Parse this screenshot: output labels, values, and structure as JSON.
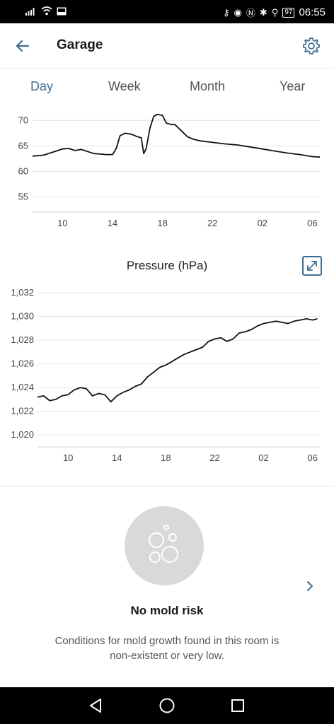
{
  "status_bar": {
    "battery": "97",
    "time": "06:55"
  },
  "header": {
    "title": "Garage",
    "back_icon": "arrow-left-icon",
    "settings_icon": "gear-icon"
  },
  "tabs": [
    {
      "label": "Day",
      "active": true
    },
    {
      "label": "Week",
      "active": false
    },
    {
      "label": "Month",
      "active": false
    },
    {
      "label": "Year",
      "active": false
    }
  ],
  "colors": {
    "accent": "#3f6e93",
    "line": "#111111",
    "grid": "#e6e6e6"
  },
  "chart_data": [
    {
      "type": "line",
      "title": "",
      "xlabel": "",
      "ylabel": "",
      "x_ticks": [
        "10",
        "14",
        "18",
        "22",
        "02",
        "06"
      ],
      "y_ticks": [
        "70",
        "65",
        "60",
        "55"
      ],
      "ylim": [
        52,
        72
      ],
      "xlim": [
        7.6,
        30.6
      ],
      "grid": true,
      "series": [
        {
          "x": [
            7.6,
            8.5,
            9.0,
            9.5,
            10.0,
            10.5,
            11.0,
            11.5,
            12.0,
            12.5,
            13.0,
            13.5,
            14.0,
            14.3,
            14.6,
            15.0,
            15.5,
            16.0,
            16.3,
            16.5,
            16.7,
            17.0,
            17.3,
            17.6,
            18.0,
            18.3,
            18.7,
            19.0,
            19.5,
            20.0,
            20.5,
            21.0,
            22.0,
            23.0,
            24.0,
            25.0,
            26.0,
            27.0,
            28.0,
            29.0,
            30.0,
            30.6
          ],
          "values": [
            63.0,
            63.2,
            63.6,
            64.0,
            64.4,
            64.5,
            64.1,
            64.3,
            63.9,
            63.5,
            63.4,
            63.3,
            63.3,
            64.5,
            67.0,
            67.5,
            67.3,
            66.8,
            66.6,
            63.5,
            64.5,
            68.5,
            70.8,
            71.2,
            71.0,
            69.5,
            69.2,
            69.2,
            68.0,
            66.8,
            66.3,
            66.0,
            65.7,
            65.4,
            65.2,
            64.8,
            64.4,
            64.0,
            63.6,
            63.3,
            62.9,
            62.8
          ]
        }
      ]
    },
    {
      "type": "line",
      "title": "Pressure (hPa)",
      "xlabel": "",
      "ylabel": "",
      "x_ticks": [
        "10",
        "14",
        "18",
        "22",
        "02",
        "06"
      ],
      "y_ticks": [
        "1,032",
        "1,030",
        "1,028",
        "1,026",
        "1,024",
        "1,022",
        "1,020"
      ],
      "ylim": [
        1019,
        1032
      ],
      "xlim": [
        7.5,
        30.6
      ],
      "grid": true,
      "series": [
        {
          "x": [
            7.5,
            8.0,
            8.5,
            9.0,
            9.5,
            10.0,
            10.5,
            11.0,
            11.5,
            12.0,
            12.5,
            13.0,
            13.5,
            14.0,
            14.5,
            15.0,
            15.5,
            16.0,
            16.5,
            17.0,
            17.5,
            18.0,
            18.5,
            19.0,
            19.5,
            20.0,
            20.5,
            21.0,
            21.5,
            22.0,
            22.5,
            23.0,
            23.5,
            24.0,
            24.5,
            25.0,
            25.5,
            26.0,
            26.5,
            27.0,
            27.5,
            28.0,
            28.5,
            29.0,
            29.5,
            30.0,
            30.4
          ],
          "values": [
            1023.2,
            1023.3,
            1022.9,
            1023.0,
            1023.3,
            1023.4,
            1023.8,
            1024.0,
            1023.9,
            1023.3,
            1023.5,
            1023.4,
            1022.8,
            1023.3,
            1023.6,
            1023.8,
            1024.1,
            1024.3,
            1024.9,
            1025.3,
            1025.7,
            1025.9,
            1026.2,
            1026.5,
            1026.8,
            1027.0,
            1027.2,
            1027.4,
            1027.9,
            1028.1,
            1028.2,
            1027.9,
            1028.1,
            1028.6,
            1028.7,
            1028.9,
            1029.2,
            1029.4,
            1029.5,
            1029.6,
            1029.5,
            1029.4,
            1029.6,
            1029.7,
            1029.8,
            1029.7,
            1029.8
          ]
        }
      ]
    }
  ],
  "pressure": {
    "title": "Pressure (hPa)",
    "expand_icon": "expand-icon"
  },
  "mold": {
    "icon": "bubbles-icon",
    "title": "No mold risk",
    "description": "Conditions for mold growth found in this room is non-existent or very low.",
    "chevron_icon": "chevron-right-icon"
  },
  "nav": {
    "back_icon": "triangle-back-icon",
    "home_icon": "circle-home-icon",
    "recents_icon": "square-recents-icon"
  }
}
